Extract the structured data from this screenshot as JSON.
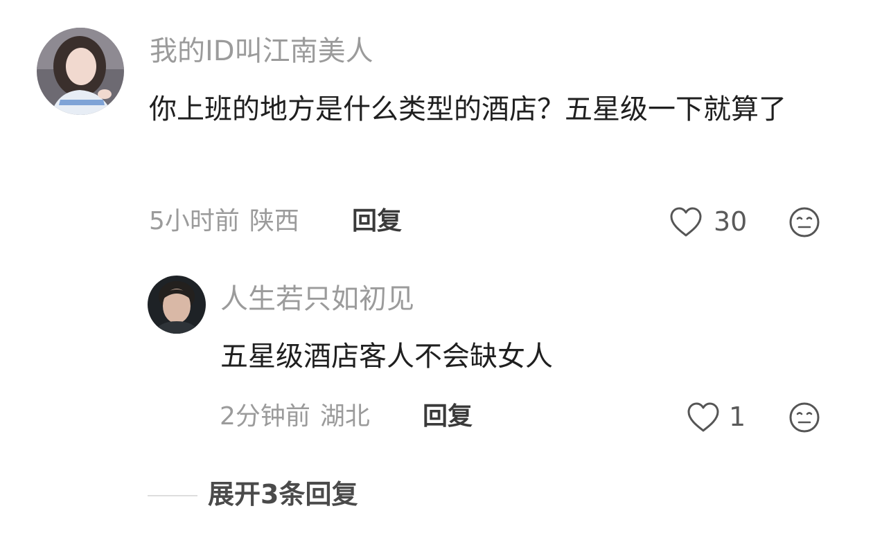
{
  "comment": {
    "avatar_icon": "user-avatar-photo",
    "username": "我的ID叫江南美人",
    "text": "你上班的地方是什么类型的酒店？五星级一下就算了",
    "time": "5小时前",
    "location": "陕西",
    "reply_label": "回复",
    "like_icon": "heart-outline-icon",
    "like_count": "30",
    "emoji_icon": "neutral-face-icon"
  },
  "reply": {
    "avatar_icon": "user-avatar-photo",
    "username": "人生若只如初见",
    "text": "五星级酒店客人不会缺女人",
    "time": "2分钟前",
    "location": "湖北",
    "reply_label": "回复",
    "like_icon": "heart-outline-icon",
    "like_count": "1",
    "emoji_icon": "neutral-face-icon"
  },
  "expand": {
    "label": "展开3条回复"
  },
  "colors": {
    "username": "#9b9b9b",
    "content": "#1f1f1f",
    "meta": "#9b9b9b",
    "reply_button": "#3a3a3a"
  }
}
